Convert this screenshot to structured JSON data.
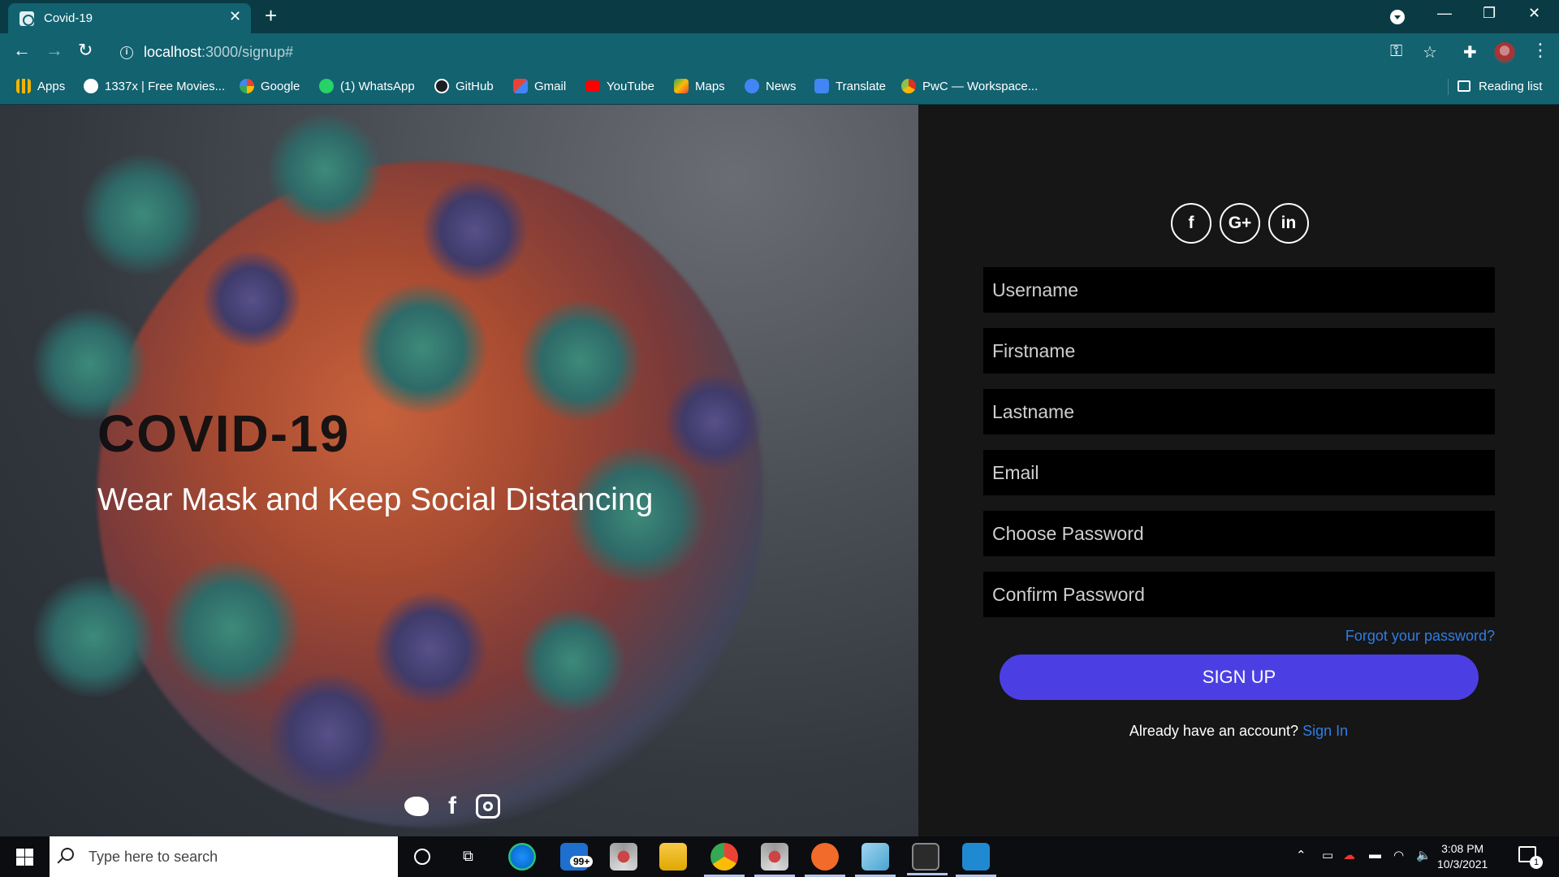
{
  "browser": {
    "tab_title": "Covid-19",
    "tab_close": "✕",
    "new_tab": "+",
    "url_host": "localhost",
    "url_path": ":3000/signup#",
    "bookmarks": [
      {
        "label": "Apps",
        "icon": "apps-grid-icon",
        "color": "#f4b400"
      },
      {
        "label": "1337x | Free Movies...",
        "icon": "1337x-icon",
        "color": "#ffffff"
      },
      {
        "label": "Google",
        "icon": "google-icon",
        "color": "#4285f4"
      },
      {
        "label": "(1) WhatsApp",
        "icon": "whatsapp-icon",
        "color": "#25d366"
      },
      {
        "label": "GitHub",
        "icon": "github-icon",
        "color": "#1b1f23"
      },
      {
        "label": "Gmail",
        "icon": "gmail-icon",
        "color": "#ea4335"
      },
      {
        "label": "YouTube",
        "icon": "youtube-icon",
        "color": "#ff0000"
      },
      {
        "label": "Maps",
        "icon": "maps-icon",
        "color": "#34a853"
      },
      {
        "label": "News",
        "icon": "news-icon",
        "color": "#4285f4"
      },
      {
        "label": "Translate",
        "icon": "translate-icon",
        "color": "#4285f4"
      },
      {
        "label": "PwC — Workspace...",
        "icon": "pwc-icon",
        "color": "#e0301e"
      }
    ],
    "reading_list": "Reading list"
  },
  "hero": {
    "title": "COVID-19",
    "subtitle": "Wear Mask and Keep Social Distancing",
    "social": [
      "twitter",
      "facebook",
      "instagram"
    ]
  },
  "signup": {
    "social_buttons": [
      "f",
      "G+",
      "in"
    ],
    "placeholders": {
      "username": "Username",
      "firstname": "Firstname",
      "lastname": "Lastname",
      "email": "Email",
      "password": "Choose Password",
      "confirm": "Confirm Password"
    },
    "forgot": "Forgot your password?",
    "submit": "SIGN UP",
    "already_text": "Already have an account?",
    "signin_link": "Sign In",
    "accent_color": "#4b3fe4",
    "link_color": "#2f7de4"
  },
  "taskbar": {
    "search_placeholder": "Type here to search",
    "mail_badge": "99+",
    "time": "3:08 PM",
    "date": "10/3/2021",
    "notification_count": "1"
  }
}
